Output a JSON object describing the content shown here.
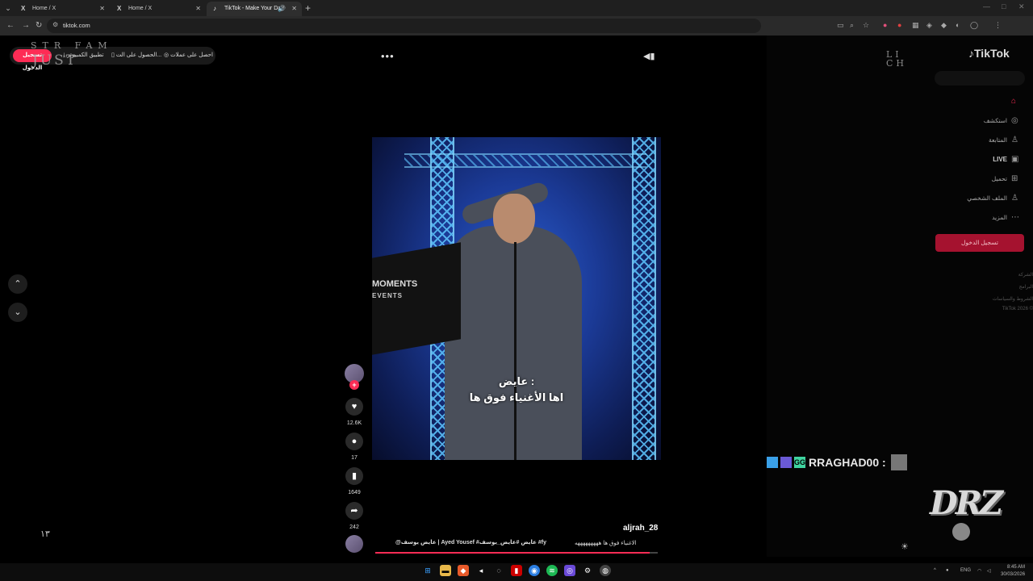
{
  "browser": {
    "tabs": [
      {
        "title": "Home / X",
        "favicon": "X",
        "active": false
      },
      {
        "title": "Home / X",
        "favicon": "X",
        "active": false
      },
      {
        "title": "TikTok - Make Your Day",
        "favicon": "tiktok-icon",
        "active": true
      }
    ],
    "url": "tiktok.com"
  },
  "topbar": {
    "login_label": "تسجيل الدخول",
    "app_label": "تطبيق الكمبيوتر",
    "get_label": "الحصول على الت...",
    "coins_label": "احصل على عملات"
  },
  "video": {
    "stage_text": "MOMENTS",
    "stage_text2": "EVENTS",
    "subtitle_line1": "عايض :",
    "subtitle_line2": "اها الأغنياء فوق ها",
    "likes": "12.6K",
    "comments": "17",
    "saves": "1649",
    "shares": "242",
    "username": "aljrah_28",
    "description": "الاغنياء فوق ها هههههههههه",
    "tags": "@عايض يوسف | Ayed Yousef #عايض #عايض_يوسف #fy",
    "progress": 0.97
  },
  "sidebar": {
    "logo": "TikTok",
    "items": [
      {
        "label": "استكشف",
        "icon": "compass-icon"
      },
      {
        "label": "المتابعة",
        "icon": "follow-icon"
      },
      {
        "label": "LIVE",
        "icon": "live-icon"
      },
      {
        "label": "تحميل",
        "icon": "upload-icon"
      },
      {
        "label": "الملف الشخصي",
        "icon": "profile-icon"
      },
      {
        "label": "المزيد",
        "icon": "more-icon"
      }
    ],
    "login_label": "تسجيل الدخول",
    "footer": [
      "الشركة",
      "البرامج",
      "الشروط والسياسات",
      "TikTok 2026 ©"
    ]
  },
  "overlay": {
    "chat_username": "RRAGHAD00 :",
    "brand": "DRZ",
    "corner_numeral": "١٣"
  },
  "taskbar": {
    "lang": "ENG",
    "time": "8:45 AM",
    "date": "30/03/2026"
  },
  "colors": {
    "accent": "#fe2c55",
    "background": "#000000"
  }
}
